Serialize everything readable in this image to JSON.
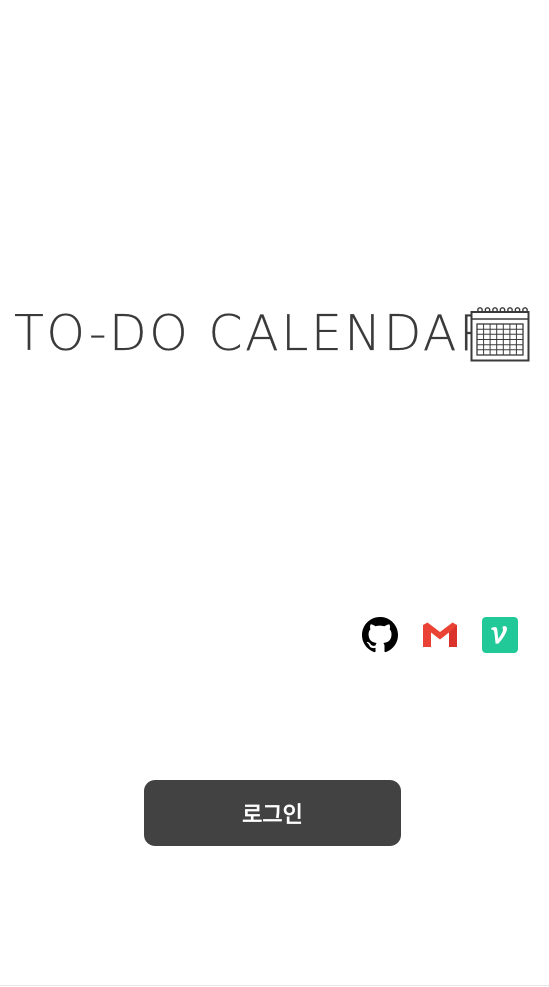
{
  "app": {
    "title": "TO-DO CALENDAR"
  },
  "logo": {
    "icon": "calendar-icon"
  },
  "social": {
    "links": [
      {
        "name": "GitHub",
        "icon": "github-icon",
        "color": "#000000"
      },
      {
        "name": "Gmail",
        "icon": "gmail-icon",
        "color": "#EA4335"
      },
      {
        "name": "Velog",
        "icon": "velog-icon",
        "color": "#20C997"
      }
    ]
  },
  "login": {
    "label": "로그인",
    "background": "#424242",
    "text_color": "#FFFFFF"
  }
}
